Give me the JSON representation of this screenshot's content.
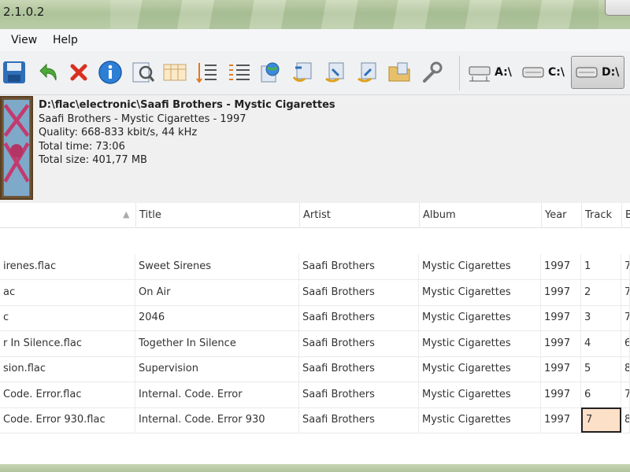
{
  "window": {
    "title": "2.1.0.2"
  },
  "menu": {
    "items": [
      "View",
      "Help"
    ]
  },
  "toolbar": {
    "icons": [
      "save-icon",
      "undo-icon",
      "delete-icon",
      "info-icon",
      "edit-tags-icon",
      "columns-icon",
      "numbering-icon",
      "list-numbering-icon",
      "web-icon",
      "convert-icon",
      "convert-down-icon",
      "convert-up-icon",
      "folder-icon",
      "settings-icon"
    ],
    "drives": [
      "A:\\",
      "C:\\",
      "D:\\"
    ],
    "active_drive": "D:\\"
  },
  "info": {
    "path": "D:\\flac\\electronic\\Saafi Brothers - Mystic Cigarettes",
    "album_line": "Saafi Brothers - Mystic Cigarettes - 1997",
    "quality": "Quality: 668-833 kbit/s, 44 kHz",
    "time": "Total time: 73:06",
    "size": "Total size: 401,77 MB"
  },
  "table": {
    "headers": {
      "title": "Title",
      "artist": "Artist",
      "album": "Album",
      "year": "Year",
      "track": "Track",
      "extra": "B"
    },
    "rows": [
      {
        "file": "irenes.flac",
        "title": "Sweet Sirenes",
        "artist": "Saafi Brothers",
        "album": "Mystic Cigarettes",
        "year": "1997",
        "track": "1",
        "extra": "7"
      },
      {
        "file": "ac",
        "title": "On Air",
        "artist": "Saafi Brothers",
        "album": "Mystic Cigarettes",
        "year": "1997",
        "track": "2",
        "extra": "7"
      },
      {
        "file": "c",
        "title": "2046",
        "artist": "Saafi Brothers",
        "album": "Mystic Cigarettes",
        "year": "1997",
        "track": "3",
        "extra": "7"
      },
      {
        "file": "r In Silence.flac",
        "title": "Together In Silence",
        "artist": "Saafi Brothers",
        "album": "Mystic Cigarettes",
        "year": "1997",
        "track": "4",
        "extra": "6"
      },
      {
        "file": "sion.flac",
        "title": "Supervision",
        "artist": "Saafi Brothers",
        "album": "Mystic Cigarettes",
        "year": "1997",
        "track": "5",
        "extra": "8"
      },
      {
        "file": " Code. Error.flac",
        "title": "Internal. Code. Error",
        "artist": "Saafi Brothers",
        "album": "Mystic Cigarettes",
        "year": "1997",
        "track": "6",
        "extra": "7"
      },
      {
        "file": " Code. Error 930.flac",
        "title": "Internal. Code. Error 930",
        "artist": "Saafi Brothers",
        "album": "Mystic Cigarettes",
        "year": "1997",
        "track": "7",
        "extra": "8"
      }
    ],
    "editing_track_row": 6
  },
  "colors": {
    "editing_cell": "#fde0c8",
    "title_bar": "#aec39a"
  }
}
